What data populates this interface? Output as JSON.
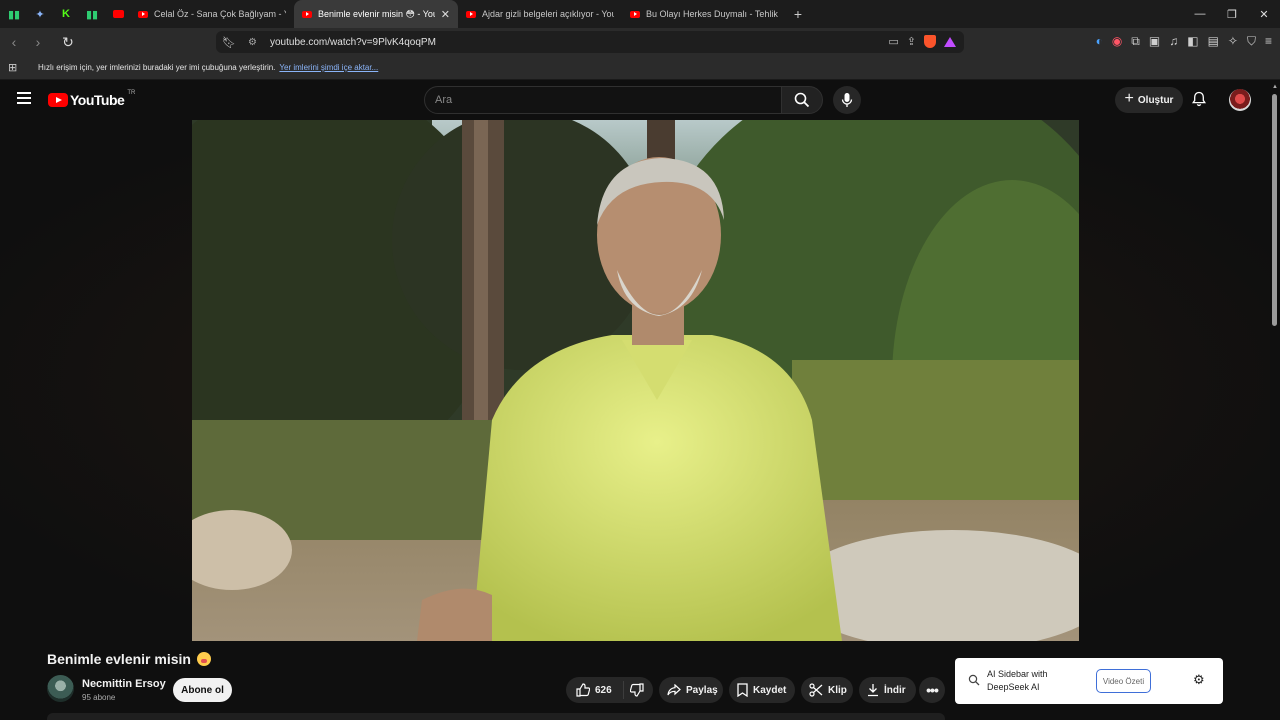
{
  "browser": {
    "pinned_tabs": [
      {
        "icon": "pinned-app-icon",
        "color": "#2ecc71"
      },
      {
        "icon": "sparkle-app-icon",
        "color": "#8ab4f8"
      },
      {
        "icon": "kick-app-icon",
        "color": "#53fc18"
      },
      {
        "icon": "pinned-app-icon",
        "color": "#2ecc71"
      },
      {
        "icon": "youtube-app-icon",
        "color": "#ff0000"
      }
    ],
    "tabs": [
      {
        "title": "Celal Öz - Sana Çok Bağlıyam - YouTube",
        "active": false
      },
      {
        "title": "Benimle evlenir misin 😳 - YouTube",
        "active": true
      },
      {
        "title": "Ajdar gizli belgeleri açıklıyor - YouTube",
        "active": false
      },
      {
        "title": "Bu Olayı Herkes Duymalı - Tehlikede",
        "active": false
      }
    ],
    "url": "youtube.com/watch?v=9PlvK4qoqPM",
    "bookmarks_prompt": "Hızlı erişim için, yer imlerinizi buradaki yer imi çubuğuna yerleştirin.",
    "bookmarks_import_link": "Yer imlerini şimdi içe aktar..."
  },
  "youtube": {
    "logo_text": "YouTube",
    "country_code": "TR",
    "search_placeholder": "Ara",
    "create_label": "Oluştur"
  },
  "video": {
    "title": "Benimle evlenir misin",
    "title_emoji": "flushed-face-emoji",
    "channel_name": "Necmittin Ersoy",
    "subscribers": "95 abone",
    "subscribe_label": "Abone ol",
    "like_count": "626",
    "share_label": "Paylaş",
    "save_label": "Kaydet",
    "clip_label": "Klip",
    "download_label": "İndir"
  },
  "ai_sidebar": {
    "line1": "AI Sidebar with",
    "line2": "DeepSeek AI",
    "button_label": "Video Özeti"
  },
  "colors": {
    "youtube_red": "#ff0000",
    "page_bg": "#0f0f0f",
    "pill_bg": "#272727",
    "ai_button_border": "#3f6fd8"
  }
}
